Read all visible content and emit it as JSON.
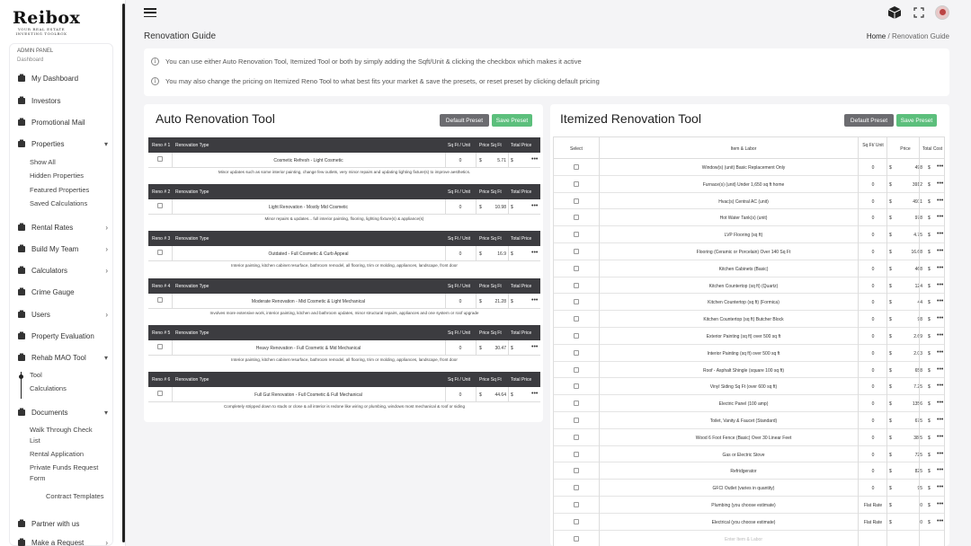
{
  "brand": {
    "name": "Reibox",
    "tagline": "YOUR REAL ESTATE INVESTING TOOLBOX"
  },
  "sidebar": {
    "admin_label": "ADMIN PANEL",
    "admin_sub": "Dashboard",
    "items": [
      {
        "label": "My Dashboard",
        "icon": "dashboard-icon"
      },
      {
        "label": "Investors",
        "icon": "users-icon"
      },
      {
        "label": "Promotional Mail",
        "icon": "mail-icon"
      },
      {
        "label": "Properties",
        "icon": "building-icon"
      },
      {
        "label": "Rental Rates",
        "icon": "rates-icon"
      },
      {
        "label": "Build My Team",
        "icon": "team-icon"
      },
      {
        "label": "Calculators",
        "icon": "calculator-icon"
      },
      {
        "label": "Crime Gauge",
        "icon": "gauge-icon"
      },
      {
        "label": "Users",
        "icon": "user-icon"
      },
      {
        "label": "Property Evaluation",
        "icon": "evaluation-icon"
      },
      {
        "label": "Rehab MAO Tool",
        "icon": "tool-icon"
      },
      {
        "label": "Documents",
        "icon": "documents-icon"
      },
      {
        "label": "Partner with us",
        "icon": "partner-icon"
      },
      {
        "label": "Make a Request",
        "icon": "request-icon"
      }
    ],
    "properties_sub": [
      "Show All",
      "Hidden Properties",
      "Featured Properties",
      "Saved Calculations"
    ],
    "rehab_sub": [
      "Tool",
      "Calculations"
    ],
    "documents_sub": [
      "Walk Through Check",
      "List",
      "Rental Application",
      "Private Funds Request",
      "Form",
      "Contract Templates"
    ]
  },
  "header": {
    "page_title": "Renovation Guide",
    "breadcrumb_home": "Home",
    "breadcrumb_sep": "/",
    "breadcrumb_current": "Renovation Guide"
  },
  "info": [
    "You can use either Auto Renovation Tool, Itemized Tool or both by simply adding the Sqft/Unit & clicking the checkbox which makes it active",
    "You may also change the pricing on Itemized Reno Tool to what best fits your market & save the presets, or reset preset by clicking default pricing"
  ],
  "auto_tool": {
    "title": "Auto Renovation Tool",
    "default_btn": "Default Preset",
    "save_btn": "Save Preset",
    "col_type": "Renovation Type",
    "col_sqft": "Sq Ft / Unit",
    "col_price": "Price Sq Ft",
    "col_total": "Total Price",
    "currency": "$",
    "menu": "•••",
    "blocks": [
      {
        "reno": "Reno # 1",
        "name": "Cosmetic Refresh - Light Cosmetic",
        "sqft": "0",
        "price": "5.71",
        "desc": "Minor updates such as some interior painting, change few outlets, very minor repairs and updating lighting fixture(s) to improve aesthetics."
      },
      {
        "reno": "Reno # 2",
        "name": "Light Renovation - Mostly Mid Cosmetic",
        "sqft": "0",
        "price": "10.98",
        "desc": "Minor repairs & updates... full interior painting, flooring, lighting fixture(s) & appliance(s)"
      },
      {
        "reno": "Reno # 3",
        "name": "Outdated - Full Cosmetic & Curb Appeal",
        "sqft": "0",
        "price": "16.9",
        "desc": "Interior painting, kitchen cabinet resurface, bathroom remodel, all flooring, trim or molding, appliances, landscape, front door"
      },
      {
        "reno": "Reno # 4",
        "name": "Moderate Renovation - Mid Cosmetic & Light Mechanical",
        "sqft": "0",
        "price": "21.28",
        "desc": "Involves more extensive work, interior painting, kitchen and bathroom updates, minor structural repairs, appliances and one system or roof upgrade"
      },
      {
        "reno": "Reno # 5",
        "name": "Heavy Renovation - Full Cosmetic & Mid Mechanical",
        "sqft": "0",
        "price": "30.47",
        "desc": "Interior painting, kitchen cabinet resurface, bathroom remodel, all flooring, trim or molding, appliances, landscape, front door"
      },
      {
        "reno": "Reno # 6",
        "name": "Full Gut Renovation - Full Cosmetic & Full Mechanical",
        "sqft": "0",
        "price": "44.64",
        "desc": "Completely stripped down to studs or close & all interior is redone like wiring or plumbing, windows most mechanical & roof or siding"
      }
    ]
  },
  "itemized_tool": {
    "title": "Itemized Renovation Tool",
    "default_btn": "Default Preset",
    "save_btn": "Save Preset",
    "col_select": "Select",
    "col_item": "Item & Labor",
    "col_sqft": "Sq Ft/ Unit",
    "col_price": "Price",
    "col_total": "Total Cost",
    "currency": "$",
    "menu": "•••",
    "rows": [
      {
        "label": "Window(s) (unit) Basic Replacement Only",
        "qty": "0",
        "price": "498"
      },
      {
        "label": "Furnace(s) (unit) Under 1,650 sq ft home",
        "qty": "0",
        "price": "3912"
      },
      {
        "label": "Hvac(s) Central AC (unit)",
        "qty": "0",
        "price": "4911"
      },
      {
        "label": "Hot Water Tank(s) (unit)",
        "qty": "0",
        "price": "978"
      },
      {
        "label": "LVP Flooring (sq ft)",
        "qty": "0",
        "price": "4.75"
      },
      {
        "label": "Flooring (Ceramic or Porcelain) Over 140 Sq Ft",
        "qty": "0",
        "price": "16.68"
      },
      {
        "label": "Kitchen Cabinets (Basic)",
        "qty": "0",
        "price": "468"
      },
      {
        "label": "Kitchen Countertop (sq ft) (Quartz)",
        "qty": "0",
        "price": "124"
      },
      {
        "label": "Kitchen Countertop (sq ft) (Formica)",
        "qty": "0",
        "price": "44"
      },
      {
        "label": "Kitchen Countertop (sq ft) Butcher Block",
        "qty": "0",
        "price": "98"
      },
      {
        "label": "Exterior Painting (sq ft) over 500 sq ft",
        "qty": "0",
        "price": "2.69"
      },
      {
        "label": "Interior Painting (sq ft) over 500 sq ft",
        "qty": "0",
        "price": "2.03"
      },
      {
        "label": "Roof - Asphalt Shingle (square 100 sq ft)",
        "qty": "0",
        "price": "658"
      },
      {
        "label": "Vinyl Siding Sq Ft (over 600 sq ft)",
        "qty": "0",
        "price": "7.25"
      },
      {
        "label": "Electric Panel (100 amp)",
        "qty": "0",
        "price": "1356"
      },
      {
        "label": "Toilet, Vanity & Faucet (Standard)",
        "qty": "0",
        "price": "675"
      },
      {
        "label": "Wood 6 Foot Fence (Basic) Over 30 Linear Feet",
        "qty": "0",
        "price": "38.5"
      },
      {
        "label": "Gas or Electric Stove",
        "qty": "0",
        "price": "725"
      },
      {
        "label": "Refridgerator",
        "qty": "0",
        "price": "825"
      },
      {
        "label": "GFCI Outlet (varies in quantity)",
        "qty": "0",
        "price": "95"
      },
      {
        "label": "Plumbing (you choose estimate)",
        "qty": "Flat Rate",
        "price": "0"
      },
      {
        "label": "Electrical (you choose estimate)",
        "qty": "Flat Rate",
        "price": "0"
      },
      {
        "label": "Enter Item & Labor",
        "qty": "",
        "price": ""
      }
    ]
  },
  "colors": {
    "dark_button": "#6c6c70",
    "green_button": "#5cbf7c",
    "table_header": "#3c3c40"
  }
}
